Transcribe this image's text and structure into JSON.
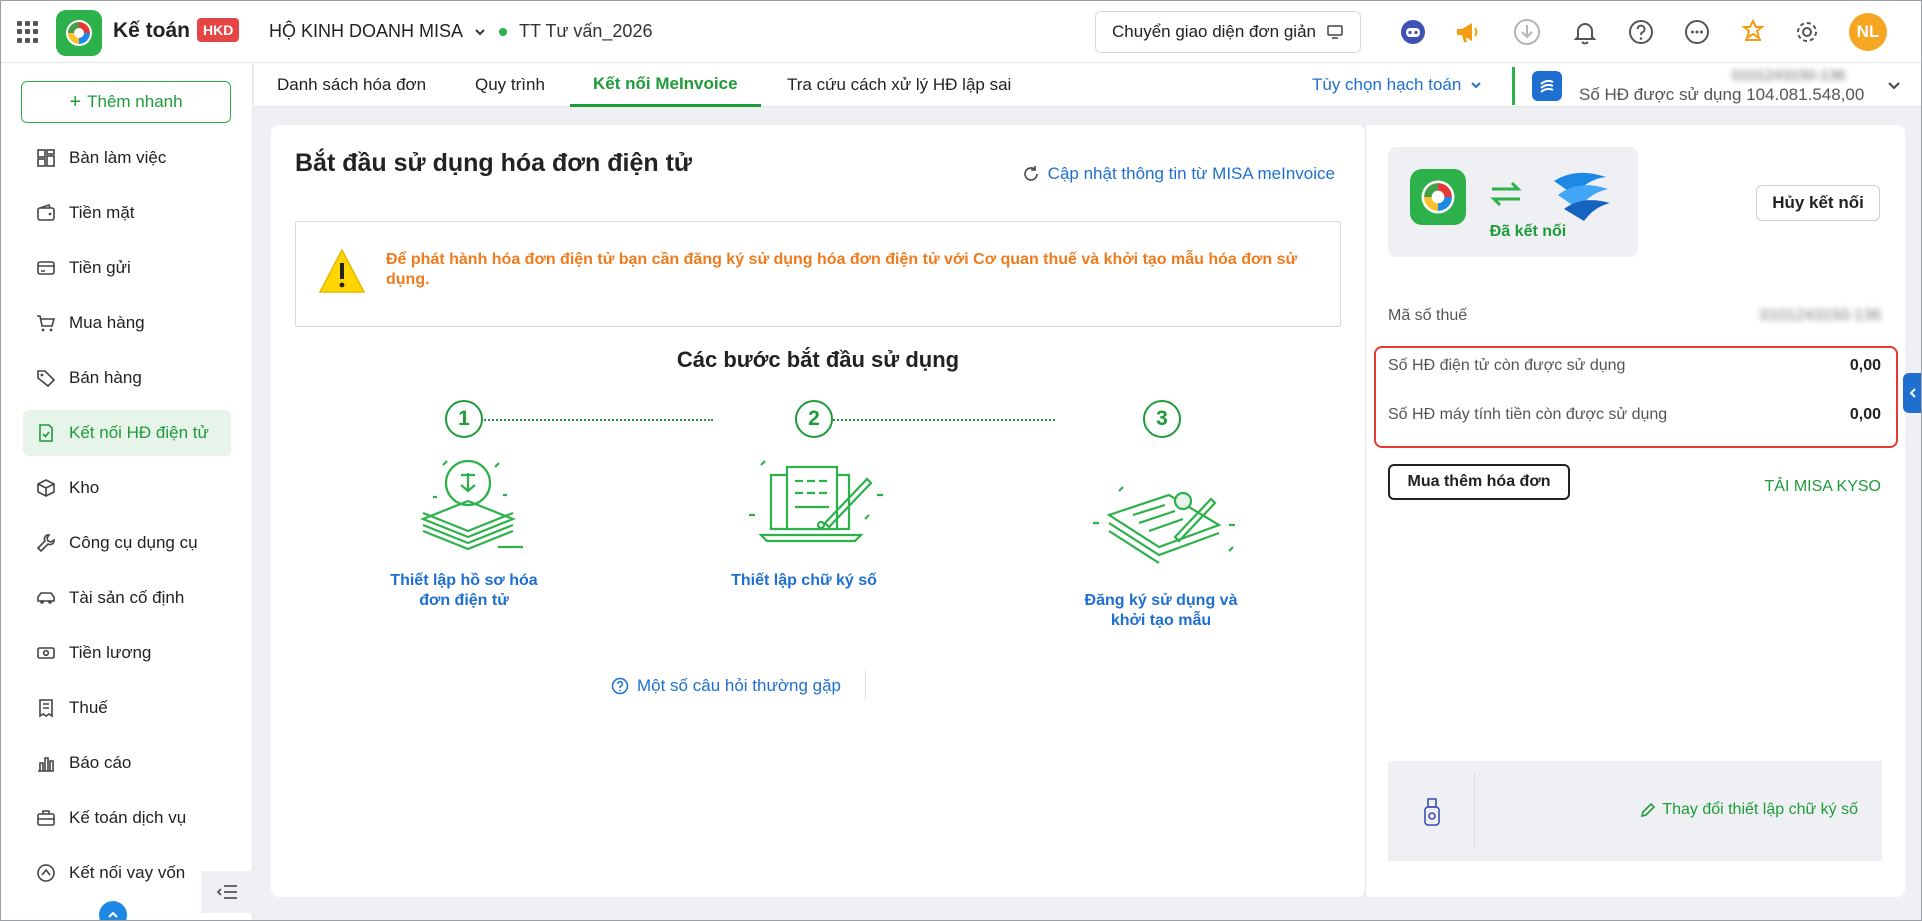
{
  "app": {
    "title": "Kế toán",
    "badge": "HKD",
    "company": "HỘ KINH DOANH MISA",
    "period": "TT Tư vấn_2026",
    "switch_ui_label": "Chuyển giao diện đơn giản",
    "avatar_initials": "NL",
    "brand_color": "#2db14a",
    "link_color": "#1e6fd0"
  },
  "toolbar_icons": [
    "assistant-icon",
    "megaphone-icon",
    "download-icon",
    "bell-icon",
    "help-icon",
    "more-icon",
    "gift-icon",
    "gear-icon"
  ],
  "sidebar": {
    "quick_add": "Thêm nhanh",
    "items": [
      {
        "label": "Bàn làm việc",
        "icon": "dashboard-icon"
      },
      {
        "label": "Tiền mặt",
        "icon": "wallet-icon"
      },
      {
        "label": "Tiền gửi",
        "icon": "card-icon"
      },
      {
        "label": "Mua hàng",
        "icon": "cart-icon"
      },
      {
        "label": "Bán hàng",
        "icon": "tag-icon"
      },
      {
        "label": "Kết nối HĐ điện tử",
        "icon": "invoice-check-icon",
        "active": true
      },
      {
        "label": "Kho",
        "icon": "box-icon"
      },
      {
        "label": "Công cụ dụng cụ",
        "icon": "wrench-icon"
      },
      {
        "label": "Tài sản cố định",
        "icon": "car-icon"
      },
      {
        "label": "Tiền lương",
        "icon": "cash-icon"
      },
      {
        "label": "Thuế",
        "icon": "receipt-icon"
      },
      {
        "label": "Báo cáo",
        "icon": "chart-icon"
      },
      {
        "label": "Kế toán dịch vụ",
        "icon": "briefcase-icon"
      },
      {
        "label": "Kết nối vay vốn",
        "icon": "loan-icon"
      }
    ]
  },
  "tabs": [
    {
      "label": "Danh sách hóa đơn"
    },
    {
      "label": "Quy trình"
    },
    {
      "label": "Kết nối MeInvoice",
      "active": true
    },
    {
      "label": "Tra cứu cách xử lý HĐ lập sai"
    }
  ],
  "tabbar": {
    "accounting_option": "Tùy chọn hạch toán",
    "tax_code_masked": "0101243150-136",
    "invoices_used": "Số HĐ được sử dụng 104.081.548,00"
  },
  "main": {
    "title": "Bắt đầu sử dụng hóa đơn điện tử",
    "refresh_link": "Cập nhật thông tin từ MISA meInvoice",
    "warning": "Để phát hành hóa đơn điện tử bạn cần đăng ký sử dụng hóa đơn điện tử với Cơ quan thuế và khởi tạo mẫu hóa đơn sử dụng.",
    "steps_title": "Các bước bắt đầu sử dụng",
    "steps": [
      {
        "number": "1",
        "label": "Thiết lập hồ sơ hóa đơn điện tử"
      },
      {
        "number": "2",
        "label": "Thiết lập chữ ký số"
      },
      {
        "number": "3",
        "label": "Đăng ký sử dụng và khởi tạo mẫu"
      }
    ],
    "faq": "Một số câu hỏi thường gặp"
  },
  "right": {
    "connected_label": "Đã kết nối",
    "disconnect_button": "Hủy kết nối",
    "tax_code_label": "Mã số thuế",
    "tax_code_value": "0101243150-136",
    "e_invoice_remaining_label": "Số HĐ điện tử còn được sử dụng",
    "e_invoice_remaining_value": "0,00",
    "cash_register_remaining_label": "Số HĐ máy tính tiền còn được sử dụng",
    "cash_register_remaining_value": "0,00",
    "buy_more_button": "Mua thêm hóa đơn",
    "download_kyso": "TẢI MISA KYSO",
    "change_signature": "Thay đổi thiết lập chữ ký số"
  }
}
